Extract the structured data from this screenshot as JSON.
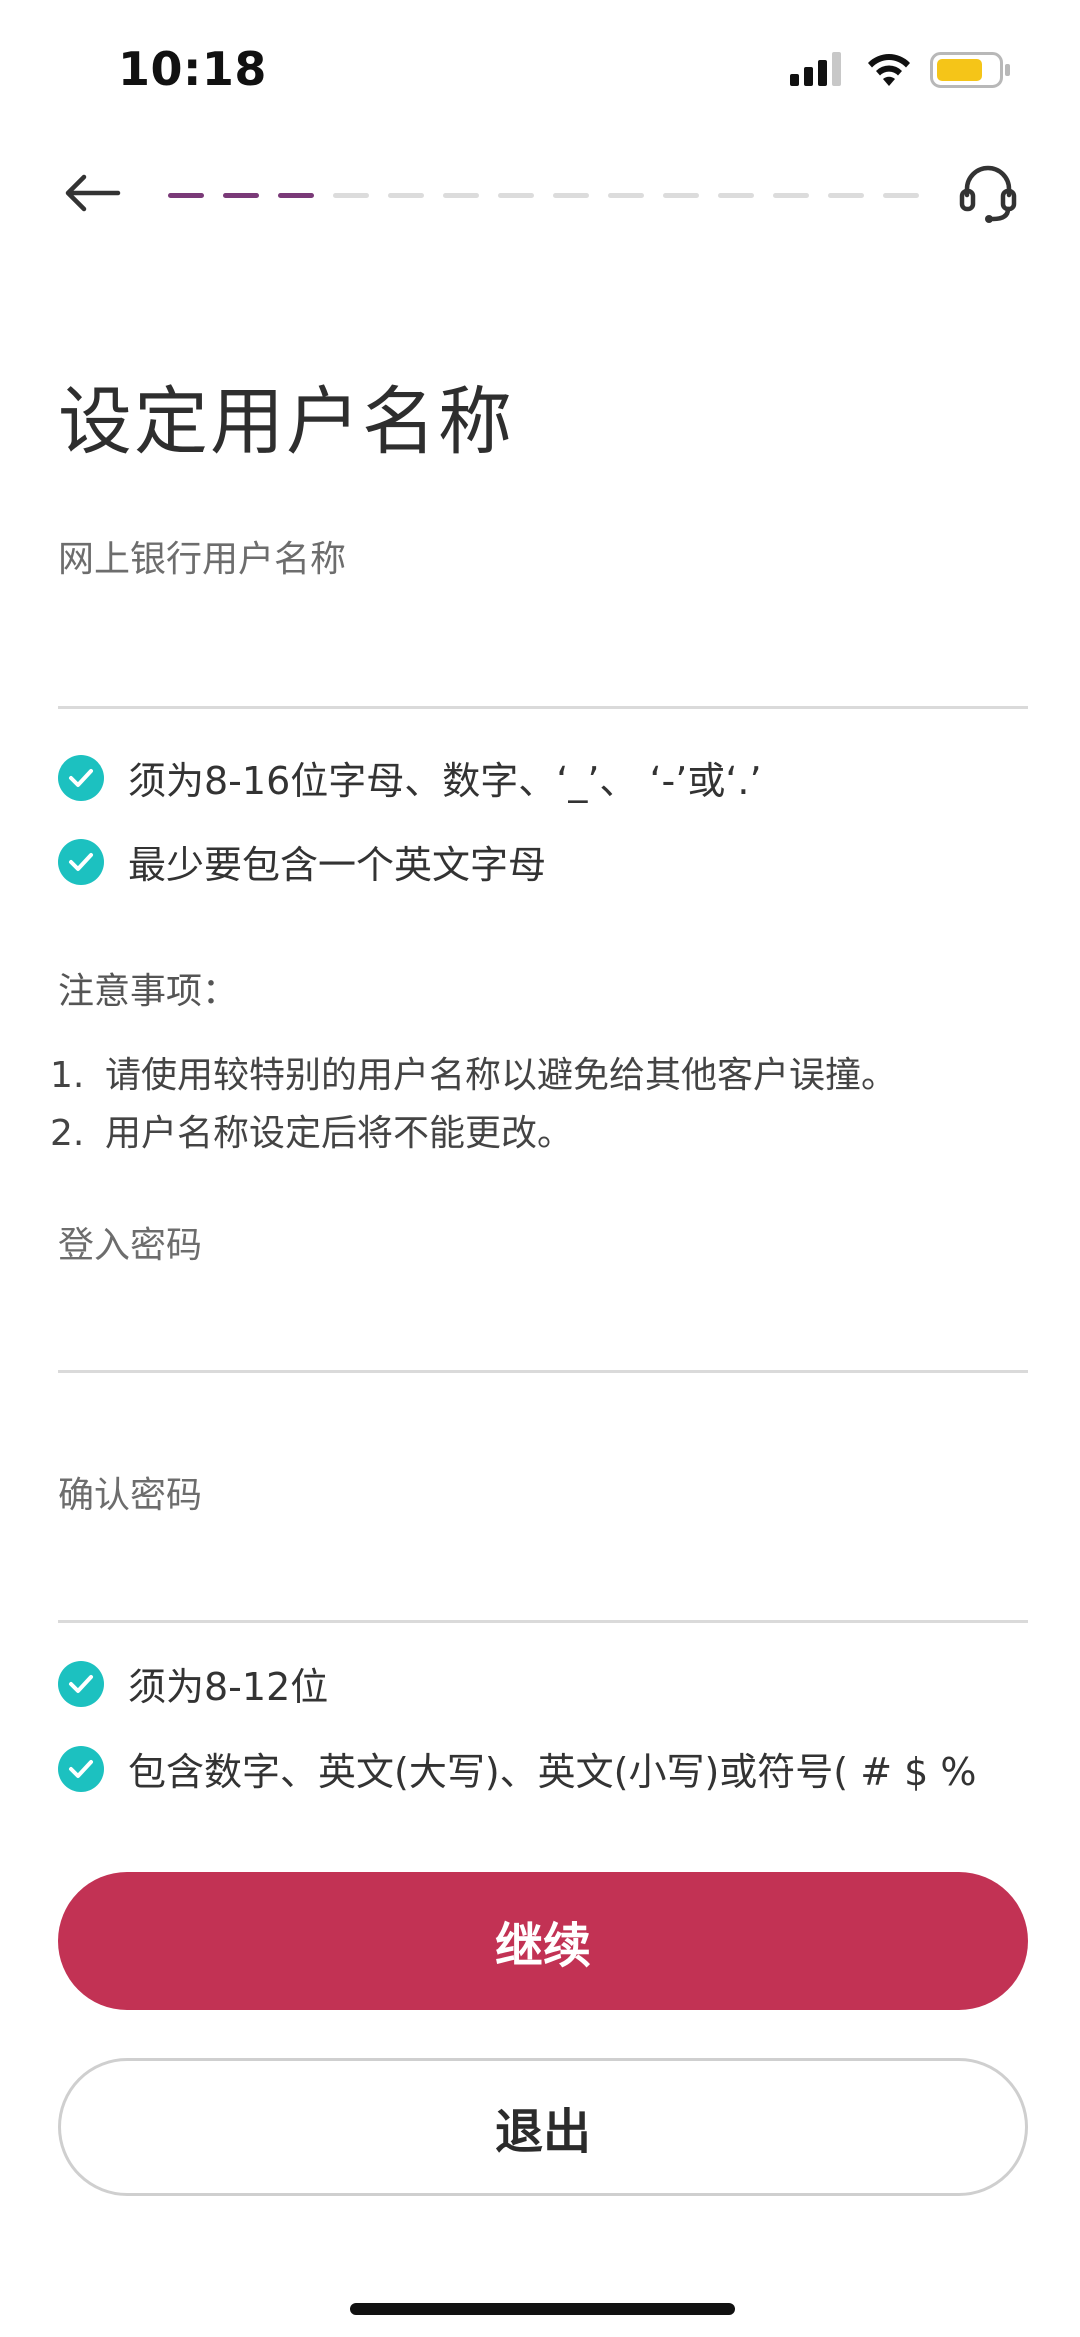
{
  "status_bar": {
    "time": "10:18",
    "icons": [
      "signal-icon",
      "wifi-icon",
      "battery-icon"
    ],
    "battery_color": "#f5c518"
  },
  "nav": {
    "back_icon": "arrow-left-icon",
    "support_icon": "headset-icon",
    "progress": {
      "completed_steps": 3,
      "total_steps": 14
    },
    "progress_active_color": "#7a3a78"
  },
  "page": {
    "title": "设定用户名称"
  },
  "username": {
    "label": "网上银行用户名称",
    "value": "",
    "rules": [
      "须为8-16位字母、数字、‘_’、 ‘-’或‘.’",
      "最少要包含一个英文字母"
    ]
  },
  "notes": {
    "title": "注意事项：",
    "items": [
      {
        "num": "1.",
        "text": "请使用较特别的用户名称以避免给其他客户误撞。"
      },
      {
        "num": "2.",
        "text": "用户名称设定后将不能更改。"
      }
    ]
  },
  "password": {
    "label": "登入密码",
    "value": ""
  },
  "confirm_password": {
    "label": "确认密码",
    "value": "",
    "rules": [
      "须为8-12位",
      "包含数字、英文(大写)、英文(小写)或符号( # $ %"
    ]
  },
  "buttons": {
    "continue": "继续",
    "exit": "退出"
  },
  "colors": {
    "check": "#1cc1c0",
    "primary_button": "#c23254"
  }
}
